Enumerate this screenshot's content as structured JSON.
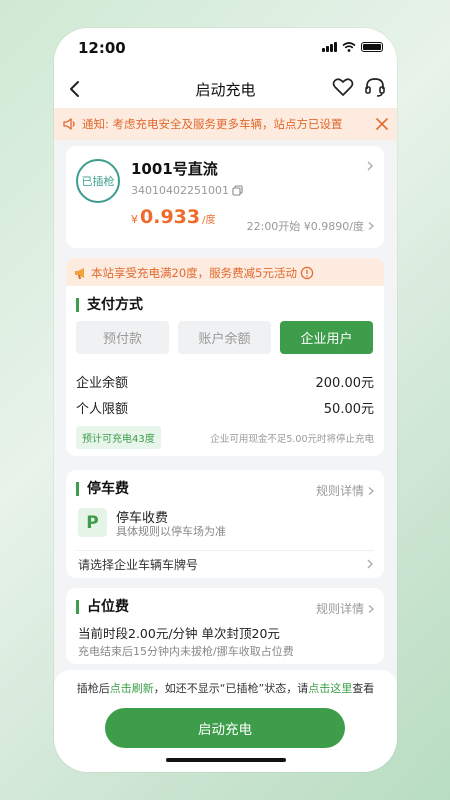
{
  "status": {
    "time": "12:00"
  },
  "nav": {
    "title": "启动充电"
  },
  "notice": {
    "text": "通知: 考虑充电安全及服务更多车辆，站点方已设置"
  },
  "station": {
    "badge": "已插枪",
    "name": "1001号直流",
    "code": "34010402251001",
    "currency": "¥",
    "price": "0.933",
    "unit": "/度",
    "next_price": "22:00开始 ¥0.9890/度"
  },
  "promo": {
    "text": "本站享受充电满20度，服务费减5元活动"
  },
  "payment": {
    "title": "支付方式",
    "options": [
      "预付款",
      "账户余额",
      "企业用户"
    ],
    "selected": "企业用户",
    "rows": [
      {
        "label": "企业余额",
        "value": "200.00元"
      },
      {
        "label": "个人限额",
        "value": "50.00元"
      }
    ],
    "estimate": "预计可充电43度",
    "note": "企业可用现金不足5.00元时将停止充电"
  },
  "parking": {
    "title": "停车费",
    "rule_link": "规则详情",
    "badge": "P",
    "item_title": "停车收费",
    "item_sub": "具体规则以停车场为准",
    "plate_prompt": "请选择企业车辆车牌号"
  },
  "occupy": {
    "title": "占位费",
    "rule_link": "规则详情",
    "line1": "当前时段2.00元/分钟   单次封顶20元",
    "line2": "充电结束后15分钟内未拔枪/挪车收取占位费"
  },
  "footer": {
    "hint_a": "插枪后",
    "hint_link1": "点击刷新",
    "hint_b": "，如还不显示“已插枪”状态，请",
    "hint_link2": "点击这里",
    "hint_c": "查看",
    "button": "启动充电"
  },
  "colors": {
    "accent": "#3d9d4a",
    "warning": "#e0692d",
    "price": "#ef6a2b"
  }
}
